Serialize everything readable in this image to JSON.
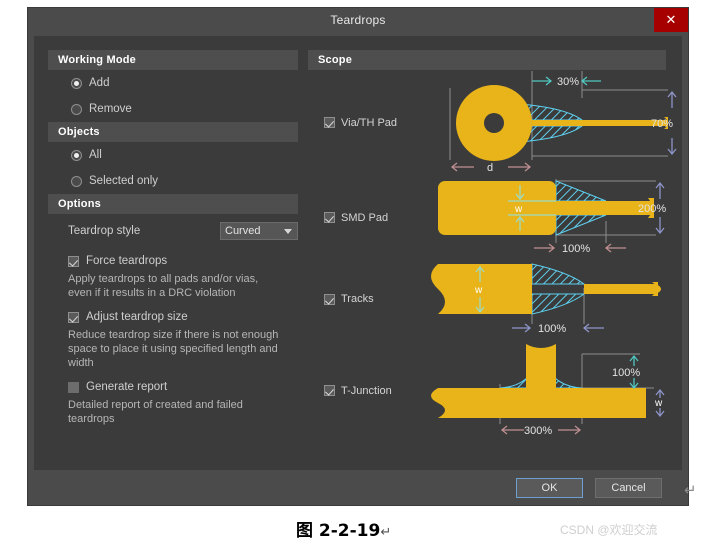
{
  "window": {
    "title": "Teardrops",
    "close_icon": "close-icon",
    "close_glyph": "✕"
  },
  "left_panel": {
    "working_mode": {
      "header": "Working Mode",
      "options": [
        {
          "label": "Add",
          "selected": true
        },
        {
          "label": "Remove",
          "selected": false
        }
      ]
    },
    "objects": {
      "header": "Objects",
      "options": [
        {
          "label": "All",
          "selected": true
        },
        {
          "label": "Selected only",
          "selected": false
        }
      ]
    },
    "options": {
      "header": "Options",
      "teardrop_style_label": "Teardrop style",
      "teardrop_style_value": "Curved",
      "teardrop_style_choices": [
        "Curved"
      ],
      "checkboxes": [
        {
          "label": "Force teardrops",
          "checked": true,
          "description": "Apply teardrops to all pads and/or vias, even if it results in a DRC violation"
        },
        {
          "label": "Adjust teardrop size",
          "checked": true,
          "description": "Reduce teardrop size if there is not enough space to place it using specified length and width"
        },
        {
          "label": "Generate report",
          "checked": false,
          "description": "Detailed report of created and failed teardrops"
        }
      ]
    }
  },
  "right_panel": {
    "header": "Scope",
    "items": [
      {
        "label": "Via/TH Pad",
        "checked": true,
        "dimensions": {
          "horizontal": "30%",
          "vertical": "70%",
          "base": "d"
        }
      },
      {
        "label": "SMD Pad",
        "checked": true,
        "dimensions": {
          "horizontal": "100%",
          "vertical": "200%",
          "base": "w"
        }
      },
      {
        "label": "Tracks",
        "checked": true,
        "dimensions": {
          "horizontal": "100%",
          "base": "w"
        }
      },
      {
        "label": "T-Junction",
        "checked": true,
        "dimensions": {
          "horizontal": "300%",
          "vertical": "100%",
          "base": "w"
        }
      }
    ]
  },
  "footer": {
    "ok_label": "OK",
    "cancel_label": "Cancel",
    "pilcrow": "↵"
  },
  "page": {
    "caption": "图 2-2-19",
    "caption_pilcrow": "↵",
    "watermark": "CSDN @欢迎交流"
  },
  "colors": {
    "copper": "#e8b419",
    "teardrop_hatch": "#5ed0ef",
    "dialog_bg": "#3b3b3b",
    "chrome": "#4b4b4b",
    "close_red": "#a60000",
    "dim_teal": "#4fc8c0",
    "dim_pink": "#c08f92",
    "dim_blue": "#8e95c9"
  }
}
